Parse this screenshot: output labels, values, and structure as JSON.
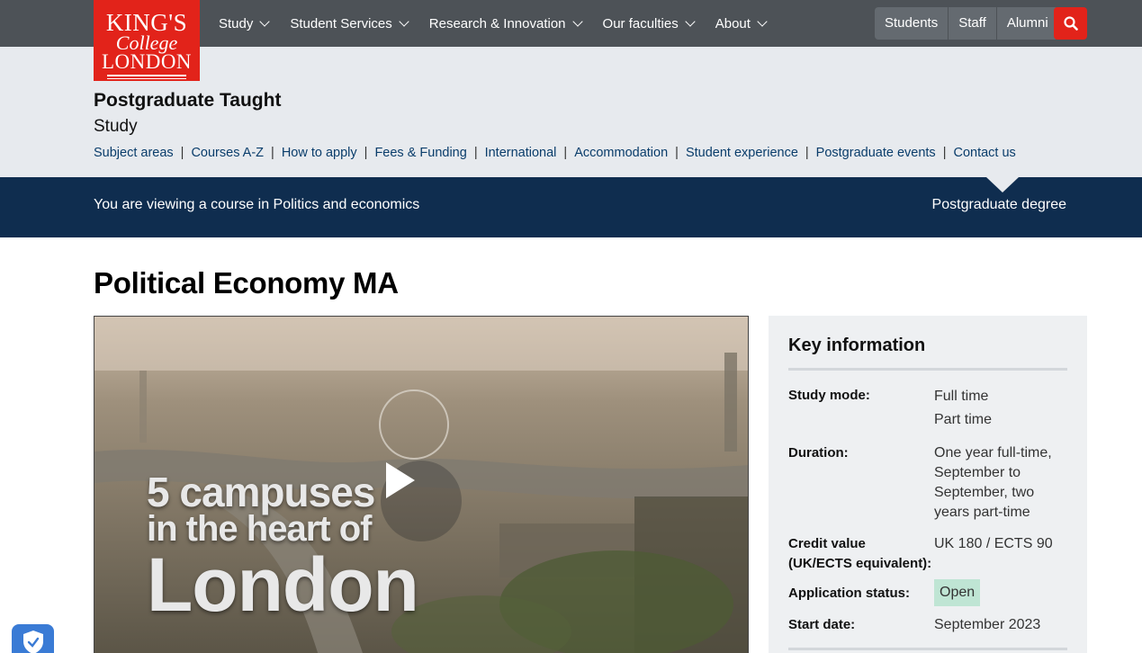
{
  "logo": {
    "line1": "KING'S",
    "line2": "College",
    "line3": "LONDON"
  },
  "mainnav": [
    "Study",
    "Student Services",
    "Research & Innovation",
    "Our faculties",
    "About"
  ],
  "audience": [
    "Students",
    "Staff",
    "Alumni"
  ],
  "section": {
    "title": "Postgraduate Taught",
    "subtitle": "Study"
  },
  "subnav": [
    "Subject areas",
    "Courses A-Z",
    "How to apply",
    "Fees & Funding",
    "International",
    "Accommodation",
    "Student experience",
    "Postgraduate events",
    "Contact us"
  ],
  "band": {
    "viewing": "You are viewing a course in Politics and economics",
    "degree": "Postgraduate degree"
  },
  "page_title": "Political Economy MA",
  "video": {
    "line1": "5 campuses",
    "line2": "in the heart of",
    "line3": "London"
  },
  "key_info": {
    "title": "Key information",
    "study_mode_label": "Study mode:",
    "study_mode_values": [
      "Full time",
      "Part time"
    ],
    "duration_label": "Duration:",
    "duration_value": "One year full-time, September to September, two years part-time",
    "credit_label": "Credit value (UK/ECTS equivalent):",
    "credit_value": "UK 180 / ECTS 90",
    "status_label": "Application status:",
    "status_value": "Open",
    "start_label": "Start date:",
    "start_value": "September 2023"
  },
  "colors": {
    "brand_red": "#e2231a",
    "nav_grey": "#4d5257",
    "band_navy": "#0f2d4f",
    "status_green": "#bfe5d4"
  }
}
